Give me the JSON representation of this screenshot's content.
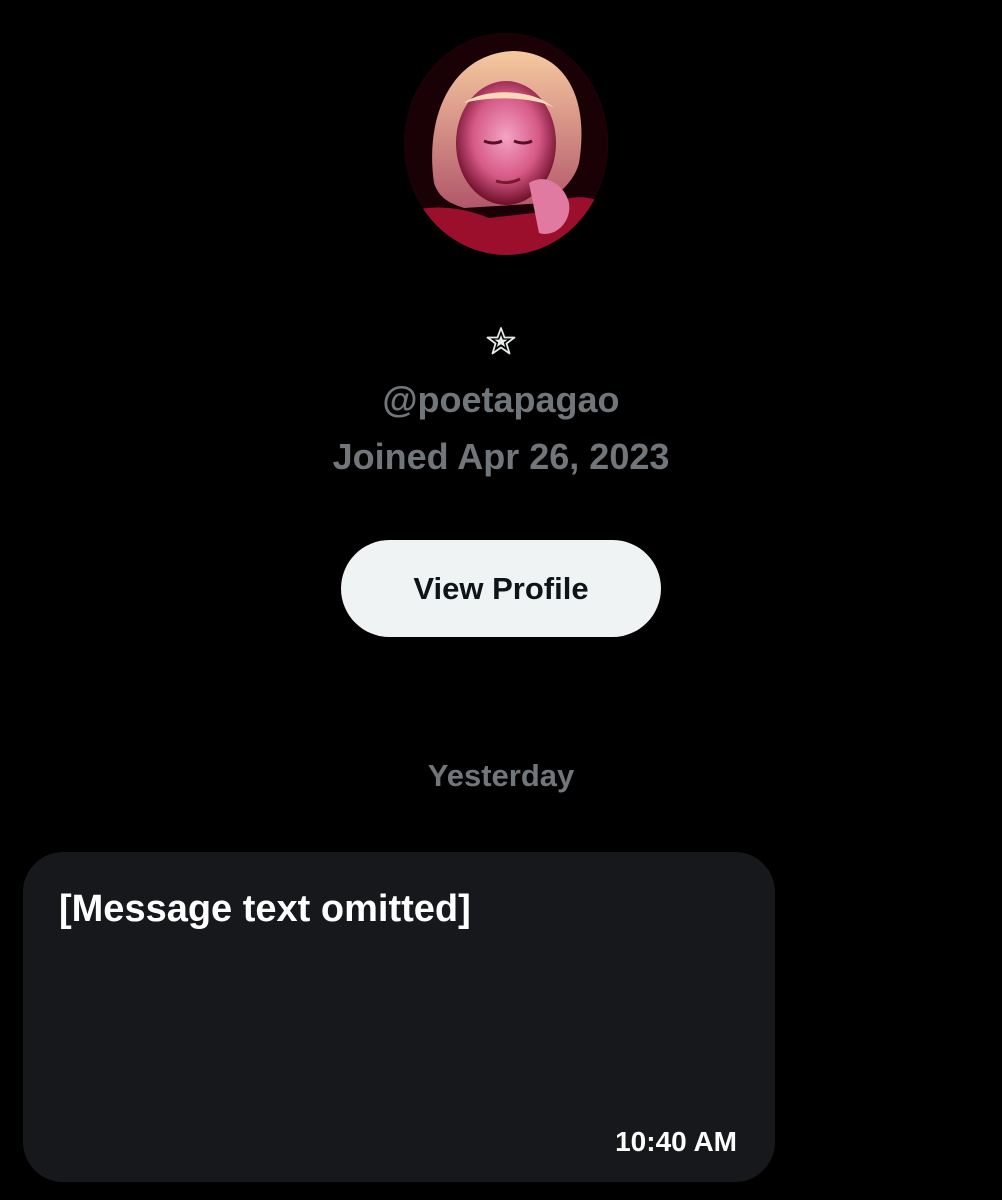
{
  "profile": {
    "badge_icon": "star-icon",
    "handle": "@poetapagao",
    "joined": "Joined Apr 26, 2023",
    "view_profile_label": "View Profile"
  },
  "conversation": {
    "date_divider": "Yesterday",
    "messages": [
      {
        "text": "[Message text omitted]",
        "time": "10:40 AM"
      }
    ]
  },
  "colors": {
    "background": "#000000",
    "secondary_text": "#71767b",
    "button_bg": "#eff3f4",
    "button_text": "#0f1419",
    "bubble_bg": "#16181c",
    "bubble_text": "#ffffff"
  }
}
